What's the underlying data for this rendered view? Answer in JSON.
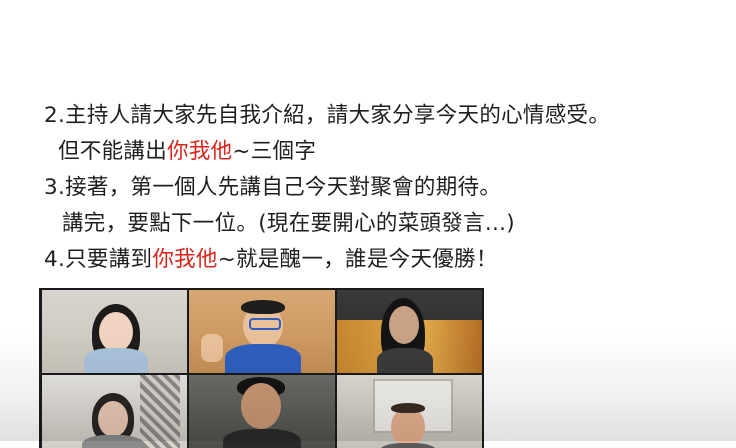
{
  "slide": {
    "line1": "2.主持人請大家先自我介紹，請大家分享今天的心情感受。",
    "line2_pre": "但不能講出",
    "line2_red": "你我他",
    "line2_post": "~三個字",
    "line3": "3.接著，第一個人先講自己今天對聚會的期待。",
    "line4": "講完，要點下一位。(現在要開心的菜頭發言...)",
    "line5_pre": "4.只要講到",
    "line5_red": "你我他",
    "line5_post": "~就是醜一，誰是今天優勝！"
  },
  "colors": {
    "text": "#1f1f1f",
    "highlight": "#d9261c",
    "video_bg": "#1a1a1a"
  },
  "video_call": {
    "participants": [
      {
        "id": "p1"
      },
      {
        "id": "p2"
      },
      {
        "id": "p3"
      },
      {
        "id": "p4"
      },
      {
        "id": "p5"
      },
      {
        "id": "p6"
      }
    ]
  }
}
